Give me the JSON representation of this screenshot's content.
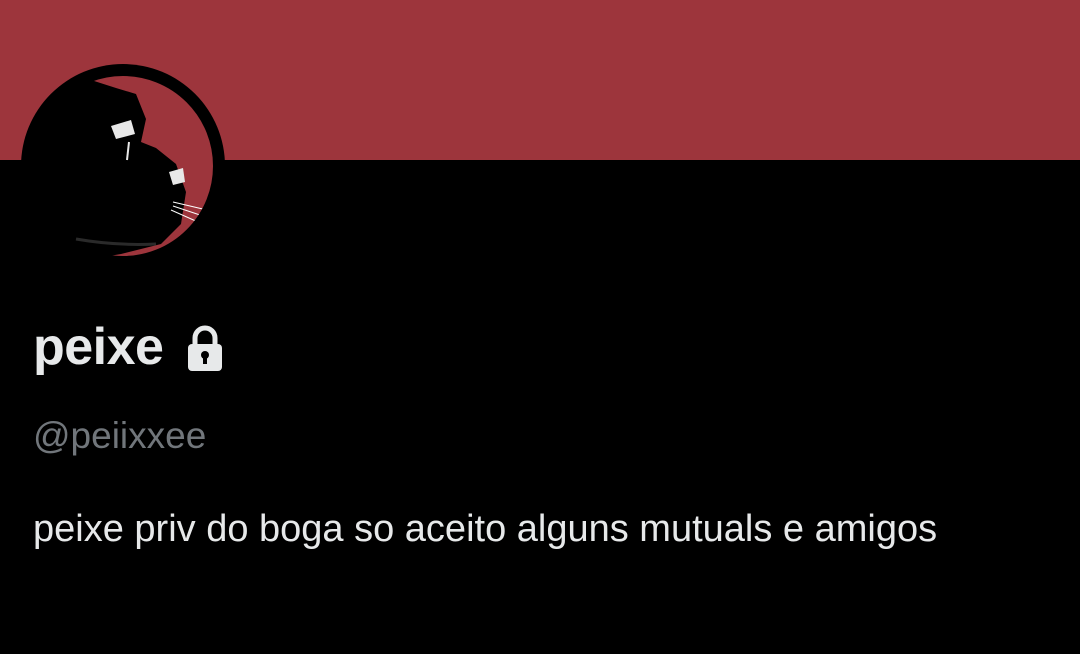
{
  "colors": {
    "banner": "#9d353c",
    "background": "#000000",
    "text_primary": "#e7e9ea",
    "text_secondary": "#71767b"
  },
  "profile": {
    "display_name": "peixe",
    "handle": "@peiixxee",
    "bio": "peixe priv do boga so aceito alguns mutuals e amigos",
    "locked": true
  },
  "icons": {
    "lock": "lock-icon",
    "avatar": "black-cat-avatar"
  }
}
